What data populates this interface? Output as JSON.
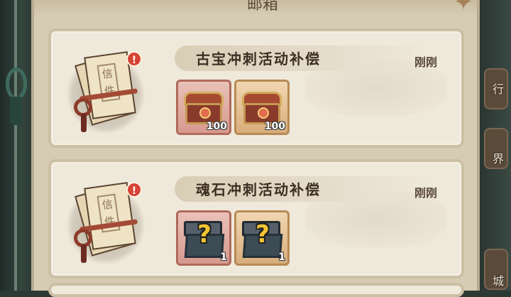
{
  "header": {
    "title_fragment": "邮箱"
  },
  "mails": [
    {
      "title": "古宝冲刺活动补偿",
      "time": "刚刚",
      "letter_label": "信件",
      "unread_badge": "!",
      "rewards": [
        {
          "kind": "treasure-chest",
          "count": "100",
          "frame": "red"
        },
        {
          "kind": "treasure-chest",
          "count": "100",
          "frame": "gold"
        }
      ]
    },
    {
      "title": "魂石冲刺活动补偿",
      "time": "刚刚",
      "letter_label": "信件",
      "unread_badge": "!",
      "rewards": [
        {
          "kind": "mystery-chest",
          "count": "1",
          "frame": "red"
        },
        {
          "kind": "mystery-chest",
          "count": "1",
          "frame": "gold"
        }
      ]
    }
  ],
  "right_nav": [
    {
      "label": "行"
    },
    {
      "label": "界"
    },
    {
      "label": "城"
    }
  ],
  "colors": {
    "panel": "#d6ccb4",
    "card": "#efe9dc",
    "badge": "#d64435"
  }
}
